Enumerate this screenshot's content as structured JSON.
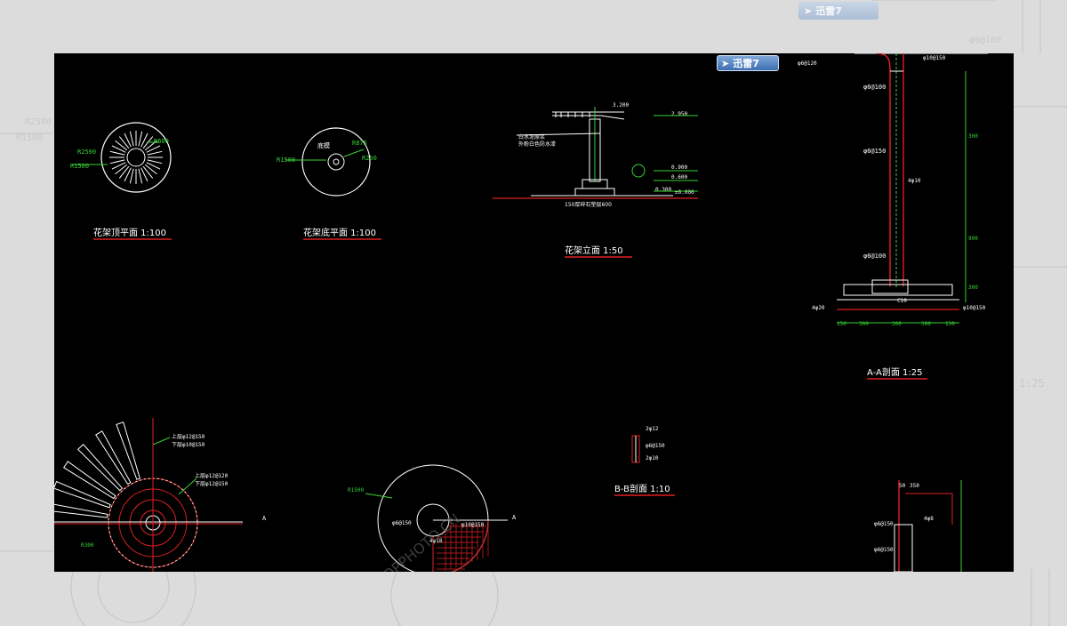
{
  "app_badge": {
    "label": "迅雷7",
    "icon": "bird-icon"
  },
  "drawings": {
    "top_plan": {
      "title": "花架顶平面 1:100",
      "labels": [
        "R2500",
        "R1500",
        "R600"
      ]
    },
    "bottom_plan": {
      "title": "花架底平面 1:100",
      "labels": [
        "底模",
        "R1500",
        "R875",
        "R250"
      ]
    },
    "elevation": {
      "title": "花架立面 1:50",
      "levels": [
        "3.200",
        "2.950",
        "0.900",
        "0.600",
        "0.300",
        "±0.000"
      ],
      "notes": [
        "白水泥原浆",
        "外粉白色防水漆",
        "150厚碎石垫层600"
      ]
    },
    "section_aa": {
      "title": "A-A剖面 1:25",
      "rebar": [
        "φ6@100",
        "φ6@150",
        "φ6@100",
        "4φ10",
        "φ10@150",
        "φ6@120",
        "φ10@150",
        "4φ20"
      ],
      "dims": [
        "150",
        "300",
        "300",
        "300",
        "150",
        "C10"
      ],
      "levels": [
        "300",
        "900",
        "300"
      ]
    },
    "section_bb": {
      "title": "B-B剖面 1:10",
      "labels": [
        "2φ12",
        "φ6@150",
        "2φ10"
      ]
    },
    "bottom_left": {
      "labels": [
        "上层φ12@150",
        "下层φ10@150",
        "上层φ12@120",
        "下层φ12@150",
        "R300",
        "A"
      ]
    },
    "bottom_middle": {
      "labels": [
        "R1500",
        "φ6@150",
        "4φ18",
        "φ10@150",
        "A"
      ]
    },
    "bottom_right": {
      "labels": [
        "50",
        "350",
        "4φ8",
        "φ6@150",
        "φ6@150"
      ]
    }
  },
  "backdrop_labels": {
    "right_title": "1:25",
    "left_a": "R2500",
    "left_b": "R1500",
    "top_right": "φ6@100"
  },
  "watermark": {
    "text": "TOPPHOTO.CN"
  },
  "colors": {
    "canvas": "#000000",
    "white": "#ffffff",
    "green": "#35d435",
    "red": "#e02020",
    "backdrop": "#dcdcdc"
  }
}
